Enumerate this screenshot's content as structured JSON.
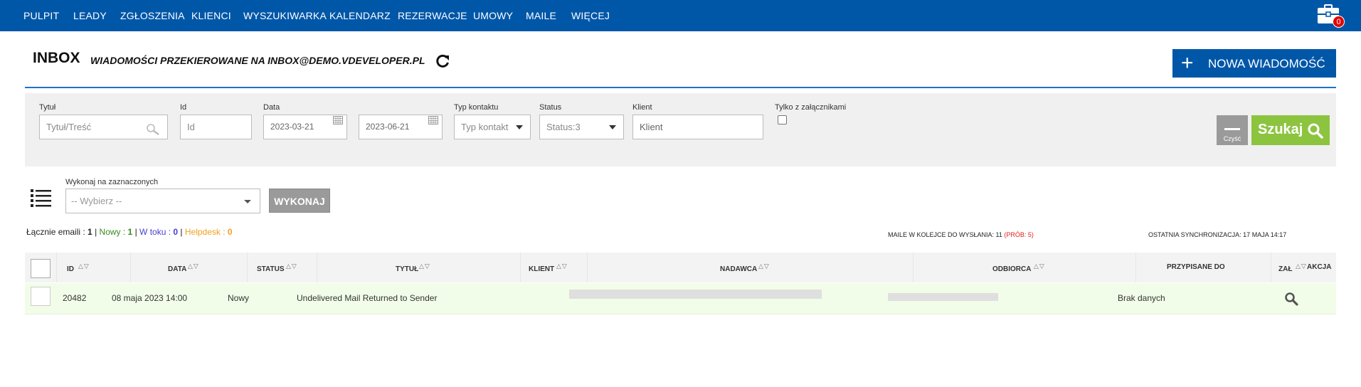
{
  "nav": {
    "items": [
      "PULPIT",
      "LEADY",
      "ZGŁOSZENIA",
      "KLIENCI",
      "WYSZUKIWARKA",
      "KALENDARZ",
      "REZERWACJE",
      "UMOWY",
      "MAILE",
      "WIĘCEJ"
    ],
    "tray_badge": "0"
  },
  "header": {
    "title": "INBOX",
    "subtitle": "WIADOMOŚCI PRZEKIEROWANE NA INBOX@DEMO.VDEVELOPER.PL",
    "new_message_label": "NOWA WIADOMOŚĆ"
  },
  "filters": {
    "title_label": "Tytuł",
    "title_placeholder": "Tytuł/Treść",
    "id_label": "Id",
    "id_placeholder": "Id",
    "date_label": "Data",
    "date_from": "2023-03-21",
    "date_to": "2023-06-21",
    "contact_type_label": "Typ kontaktu",
    "contact_type_value": "Typ kontakt",
    "status_label": "Status",
    "status_value": "Status:3",
    "client_label": "Klient",
    "client_placeholder": "Klient",
    "attachments_label": "Tylko z załącznikami",
    "clear_label": "Czyść",
    "search_label": "Szukaj"
  },
  "bulk": {
    "label": "Wykonaj na zaznaczonych",
    "select_value": "-- Wybierz --",
    "execute_label": "WYKONAJ"
  },
  "stats": {
    "total_label": "Łącznie emaili : ",
    "total": "1",
    "new_label": "Nowy : ",
    "new": "1",
    "in_progress_label": "W toku : ",
    "in_progress": "0",
    "helpdesk_label": "Helpdesk : ",
    "helpdesk": "0",
    "queue_label": "MAILE W KOLEJCE DO WYSŁANIA: 11 ",
    "queue_attempts": "(PRÓB: 5)",
    "sync_label": "OSTATNIA SYNCHRONIZACJA: 17 MAJA 14:17"
  },
  "table": {
    "columns": [
      "ID",
      "DATA",
      "STATUS",
      "TYTUŁ",
      "KLIENT",
      "NADAWCA",
      "ODBIORCA",
      "PRZYPISANE DO",
      "ZAŁ",
      "AKCJA"
    ],
    "sort_glyph": "△▽",
    "rows": [
      {
        "id": "20482",
        "date": "08 maja 2023 14:00",
        "status": "Nowy",
        "title": "Undelivered Mail Returned to Sender",
        "client": "",
        "assigned": "Brak danych"
      }
    ]
  },
  "colors": {
    "nav_bg": "#0057a8",
    "accent_line": "#1e73c8",
    "search_green": "#8cc43f",
    "row_bg": "#f2fde9",
    "badge_red": "#e00000"
  }
}
